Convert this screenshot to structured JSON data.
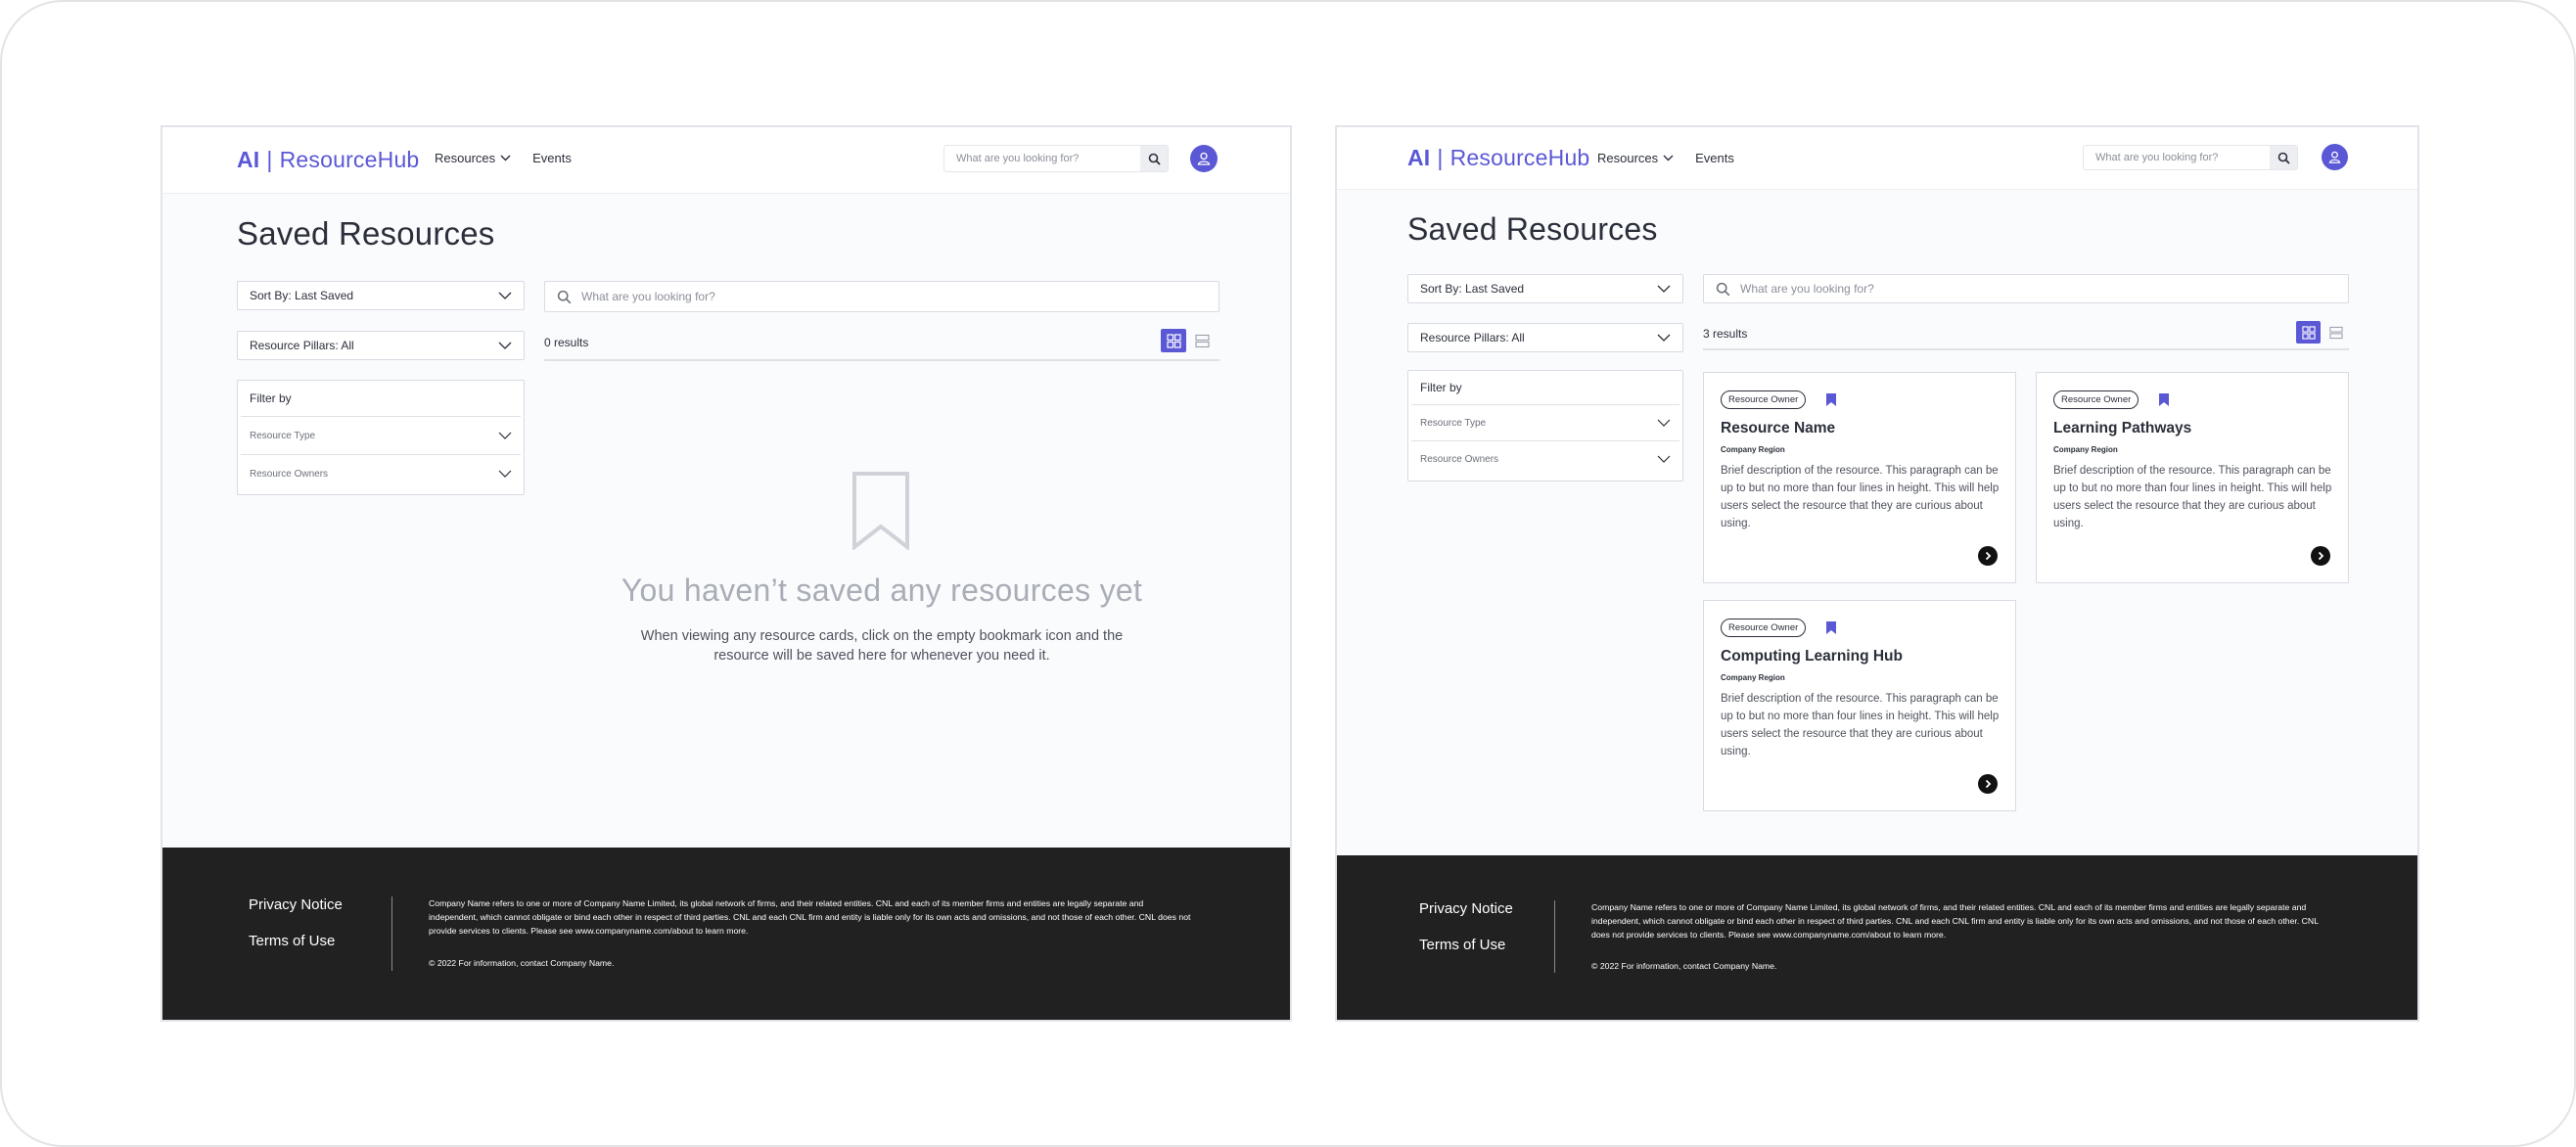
{
  "brand": {
    "ai": "AI",
    "separator": "|",
    "name": "ResourceHub"
  },
  "nav": {
    "resources": "Resources",
    "events": "Events"
  },
  "header_search": {
    "placeholder": "What are you looking for?"
  },
  "page": {
    "title": "Saved Resources"
  },
  "controls": {
    "sort": "Sort By: Last Saved",
    "pillars": "Resource Pillars: All",
    "search_placeholder": "What are you looking for?"
  },
  "filter": {
    "heading": "Filter by",
    "rows": [
      "Resource Type",
      "Resource Owners"
    ]
  },
  "empty_state": {
    "results": "0 results",
    "heading": "You haven’t saved any resources yet",
    "message": "When viewing any resource cards, click on the empty bookmark icon and the resource will be saved here for whenever you need it."
  },
  "saved_state": {
    "results": "3 results",
    "cards": [
      {
        "badge": "Resource Owner",
        "name": "Resource Name",
        "region": "Company Region",
        "description": "Brief description of the resource. This paragraph can be up to but no more than four lines in height. This will help users select the resource that they are curious about using."
      },
      {
        "badge": "Resource Owner",
        "name": "Learning Pathways",
        "region": "Company Region",
        "description": "Brief description of the resource. This paragraph can be up to but no more than four lines in height. This will help users select the resource that they are curious about using."
      },
      {
        "badge": "Resource Owner",
        "name": "Computing Learning Hub",
        "region": "Company Region",
        "description": "Brief description of the resource. This paragraph can be up to but no more than four lines in height. This will help users select the resource that they are curious about using."
      }
    ]
  },
  "footer": {
    "privacy": "Privacy Notice",
    "terms": "Terms of Use",
    "legal": "Company Name refers to one or more of Company Name Limited, its global network of firms, and their related entities. CNL and each of its member firms and entities are legally separate and independent, which cannot obligate or bind each other in respect of third parties. CNL and each CNL firm and entity is liable only for its own acts and omissions, and not those of each other. CNL does not provide services to clients. Please see www.companyname.com/about to learn more.",
    "copyright": "© 2022 For information, contact Company Name."
  },
  "colors": {
    "accent": "#5b58d6",
    "footer_bg": "#212121",
    "text": "#2b2f3a"
  },
  "icons": [
    "search-icon",
    "chevron-down-icon",
    "user-icon",
    "bookmark-icon",
    "grid-view-icon",
    "list-view-icon",
    "arrow-right-icon"
  ]
}
